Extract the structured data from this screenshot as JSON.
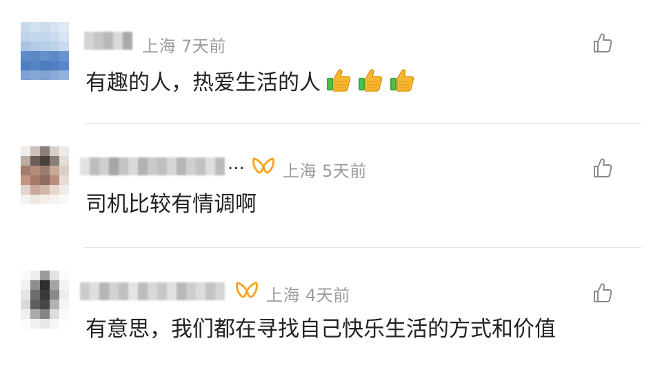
{
  "comments": [
    {
      "location": "上海",
      "time": "7天前",
      "text": "有趣的人，热爱生活的人",
      "emoji": [
        "thumbs-up",
        "thumbs-up",
        "thumbs-up"
      ],
      "has_badge": false
    },
    {
      "location": "上海",
      "time": "5天前",
      "text": "司机比较有情调啊",
      "has_badge": true,
      "name_truncated": "..."
    },
    {
      "location": "上海",
      "time": "4天前",
      "text": "有意思，我们都在寻找自己快乐生活的方式和价值",
      "has_badge": true
    }
  ],
  "colors": {
    "meta": "#9b9b9b",
    "text": "#222222",
    "divider": "#e6e6e6",
    "badge": "#f5a623",
    "like_icon": "#8a8a8a"
  },
  "icons": [
    "like-icon",
    "thumbs-up-emoji",
    "member-badge-icon"
  ]
}
